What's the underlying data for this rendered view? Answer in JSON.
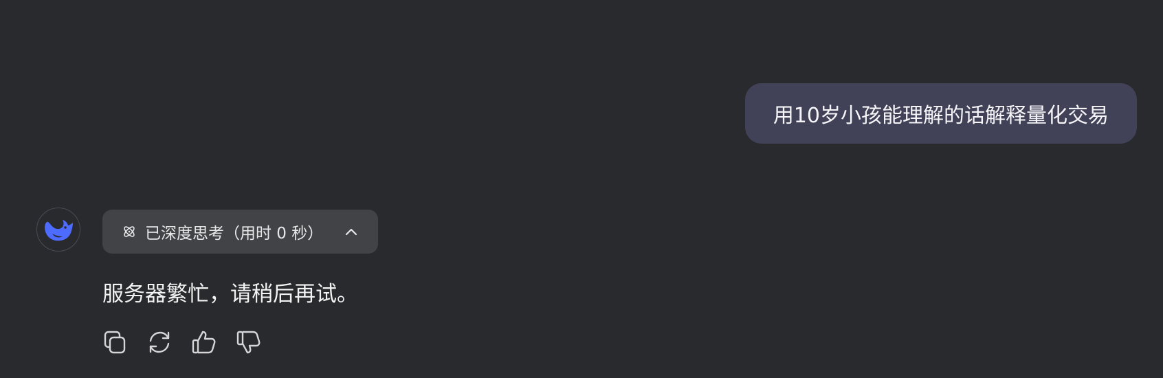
{
  "conversation": {
    "user_message": "用10岁小孩能理解的话解释量化交易",
    "assistant": {
      "avatar_icon": "whale-logo-icon",
      "thinking_label": "已深度思考（用时 0 秒）",
      "reply": "服务器繁忙，请稍后再试。"
    }
  },
  "actions": [
    {
      "icon": "copy-icon"
    },
    {
      "icon": "regenerate-icon"
    },
    {
      "icon": "thumbs-up-icon"
    },
    {
      "icon": "thumbs-down-icon"
    }
  ],
  "colors": {
    "background": "#292a2d",
    "user_bubble": "#414158",
    "chip": "#424346",
    "accent": "#4d6bfe"
  }
}
